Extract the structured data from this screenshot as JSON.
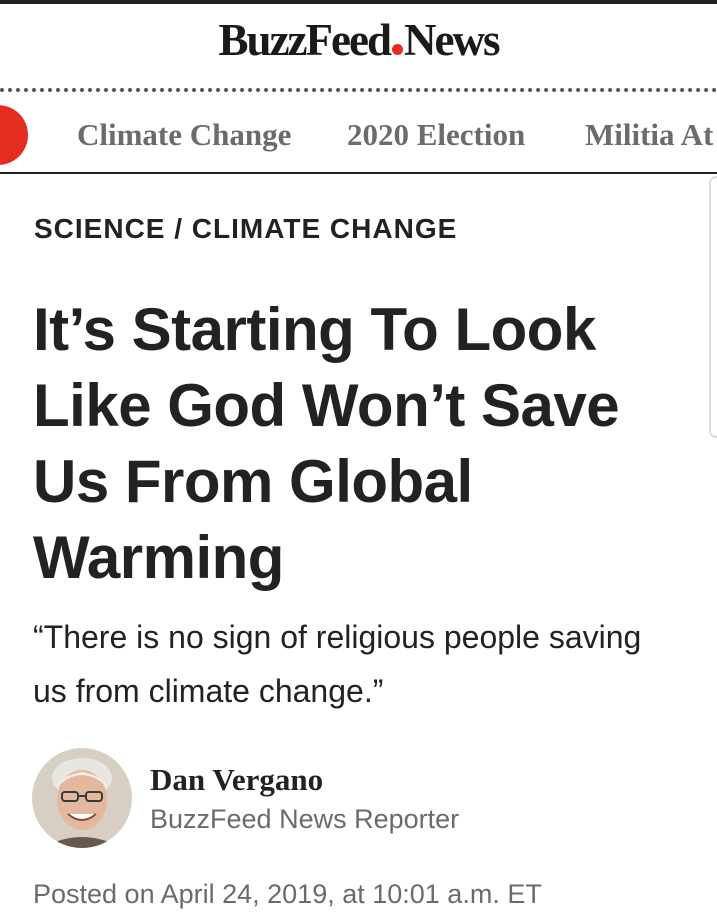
{
  "brand": {
    "logo_part1": "BuzzFeed",
    "logo_part2": "News",
    "accent_color": "#e42c20"
  },
  "nav": {
    "items": [
      {
        "label": "Climate Change"
      },
      {
        "label": "2020 Election"
      },
      {
        "label": "Militia At"
      }
    ]
  },
  "article": {
    "kicker": "SCIENCE / CLIMATE CHANGE",
    "headline": "It’s Starting To Look Like God Won’t Save Us From Global Warming",
    "dek": "“There is no sign of religious people saving us from climate change.”",
    "author": {
      "name": "Dan Vergano",
      "role": "BuzzFeed News Reporter",
      "avatar_icon": "author-photo"
    },
    "posted": "Posted on April 24, 2019, at 10:01 a.m. ET"
  }
}
